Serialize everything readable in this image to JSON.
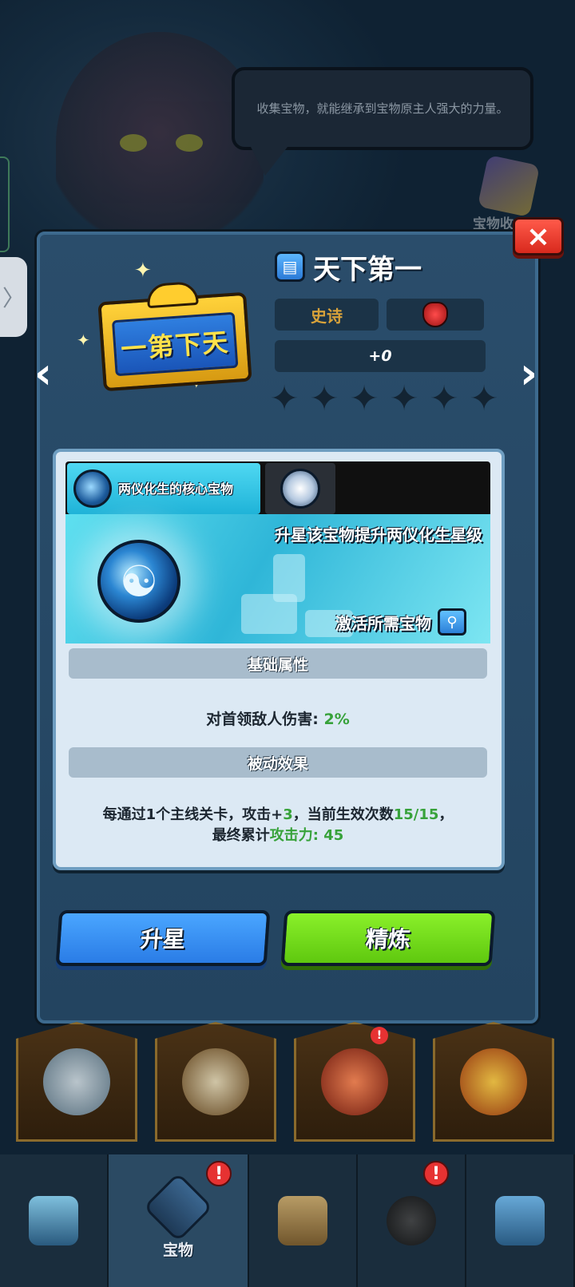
{
  "background": {
    "speech_text": "收集宝物，就能继承到宝物原主人强大的力量。",
    "collection_label": "宝物收"
  },
  "modal": {
    "plaque_text": "一第下天",
    "title": "天下第一",
    "rarity": "史诗",
    "refine_level": "+0",
    "star_count_filled": 0,
    "star_count_total": 6,
    "close_label": "×",
    "prev_label": "‹",
    "next_label": "›",
    "tabs": [
      {
        "label": "两仪化生的核心宝物",
        "icon": "yin-yang-orb-icon"
      },
      {
        "label": "",
        "icon": "dragon-hero-icon"
      }
    ],
    "banner_text": "升星该宝物提升两仪化生星级",
    "activate_label": "激活所需宝物",
    "basic_attr_header": "基础属性",
    "basic_attr_label": "对首领敌人伤害:",
    "basic_attr_value": "2%",
    "passive_header": "被动效果",
    "passive_text_1": "每通过1个主线关卡，攻击+",
    "passive_plus": "3",
    "passive_text_2": "，当前生效次数",
    "passive_count": "15/15",
    "passive_text_3": "，",
    "passive_text_4": "最终累计",
    "passive_attack_label": "攻击力: 45",
    "star_up_button": "升星",
    "refine_button": "精炼"
  },
  "bottom_nav": {
    "items": [
      {
        "label": "",
        "icon": "ice-castle-icon"
      },
      {
        "label": "宝物",
        "icon": "treasure-shield-icon",
        "badge": "!"
      },
      {
        "label": "",
        "icon": "scroll-map-icon"
      },
      {
        "label": "",
        "icon": "heroes-icon",
        "badge": "!"
      },
      {
        "label": "",
        "icon": "gift-box-icon"
      }
    ]
  },
  "colors": {
    "accent_blue": "#2a7ce6",
    "accent_green": "#5fc80f",
    "modal_bg": "#234460",
    "value_green": "#37a23a"
  }
}
